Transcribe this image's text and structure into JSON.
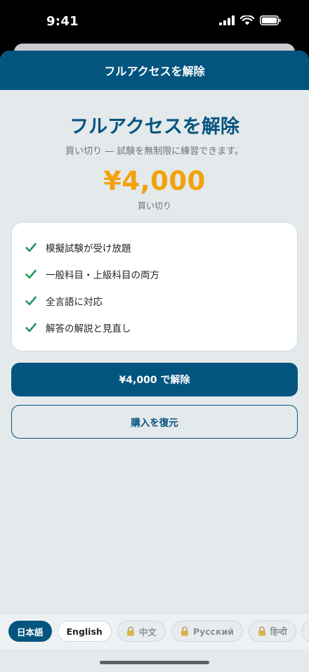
{
  "status_bar": {
    "time": "9:41"
  },
  "header": {
    "title": "フルアクセスを解除"
  },
  "hero": {
    "title": "フルアクセスを解除",
    "subtitle": "買い切り — 試験を無制限に練習できます。",
    "price": "¥4,000",
    "price_caption": "買い切り"
  },
  "features": [
    {
      "label": "模擬試験が受け放題"
    },
    {
      "label": "一般科目・上級科目の両方"
    },
    {
      "label": "全言語に対応"
    },
    {
      "label": "解答の解説と見直し"
    }
  ],
  "actions": {
    "unlock_label": "¥4,000 で解除",
    "restore_label": "購入を復元"
  },
  "languages": [
    {
      "label": "日本語",
      "state": "active"
    },
    {
      "label": "English",
      "state": "normal"
    },
    {
      "label": "中文",
      "state": "locked"
    },
    {
      "label": "Русский",
      "state": "locked"
    },
    {
      "label": "हिन्दी",
      "state": "locked"
    }
  ],
  "colors": {
    "brand": "#03557f",
    "accent_price": "#f2a20c",
    "check": "#1e9a5b"
  }
}
